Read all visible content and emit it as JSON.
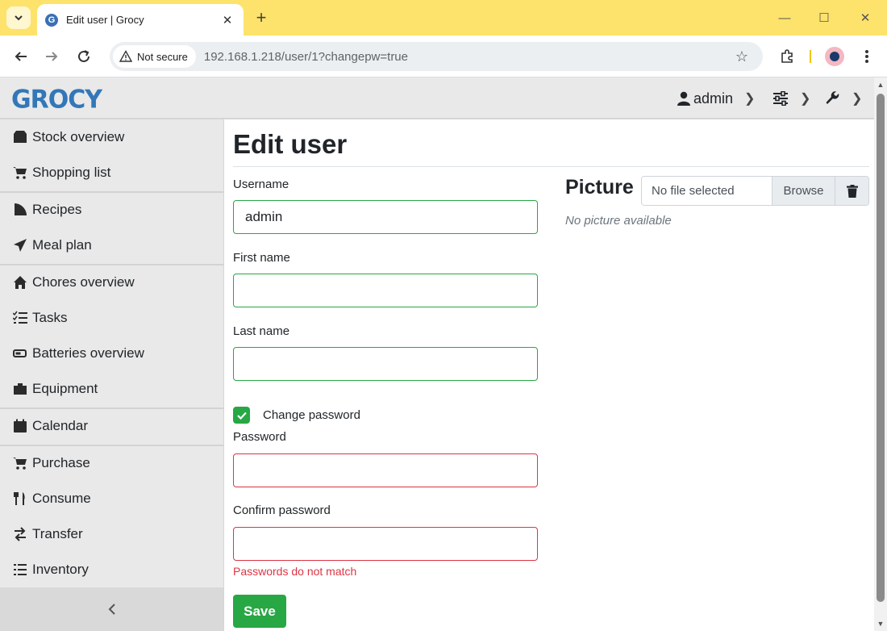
{
  "browser": {
    "tab_title": "Edit user | Grocy",
    "security_label": "Not secure",
    "url": "192.168.1.218/user/1?changepw=true"
  },
  "header": {
    "logo": "GROCY",
    "user": "admin"
  },
  "sidebar": {
    "items": [
      {
        "label": "Stock overview"
      },
      {
        "label": "Shopping list"
      },
      {
        "label": "Recipes"
      },
      {
        "label": "Meal plan"
      },
      {
        "label": "Chores overview"
      },
      {
        "label": "Tasks"
      },
      {
        "label": "Batteries overview"
      },
      {
        "label": "Equipment"
      },
      {
        "label": "Calendar"
      },
      {
        "label": "Purchase"
      },
      {
        "label": "Consume"
      },
      {
        "label": "Transfer"
      },
      {
        "label": "Inventory"
      }
    ]
  },
  "form": {
    "title": "Edit user",
    "username_label": "Username",
    "username_value": "admin",
    "firstname_label": "First name",
    "firstname_value": "",
    "lastname_label": "Last name",
    "lastname_value": "",
    "change_password_label": "Change password",
    "change_password_checked": true,
    "password_label": "Password",
    "confirm_label": "Confirm password",
    "error": "Passwords do not match",
    "save_label": "Save"
  },
  "picture": {
    "title": "Picture",
    "file_placeholder": "No file selected",
    "browse_label": "Browse",
    "no_picture": "No picture available"
  },
  "colors": {
    "success": "#28a745",
    "danger": "#dc3545",
    "brand": "#3377b8",
    "chrome_accent": "#fde36b"
  }
}
